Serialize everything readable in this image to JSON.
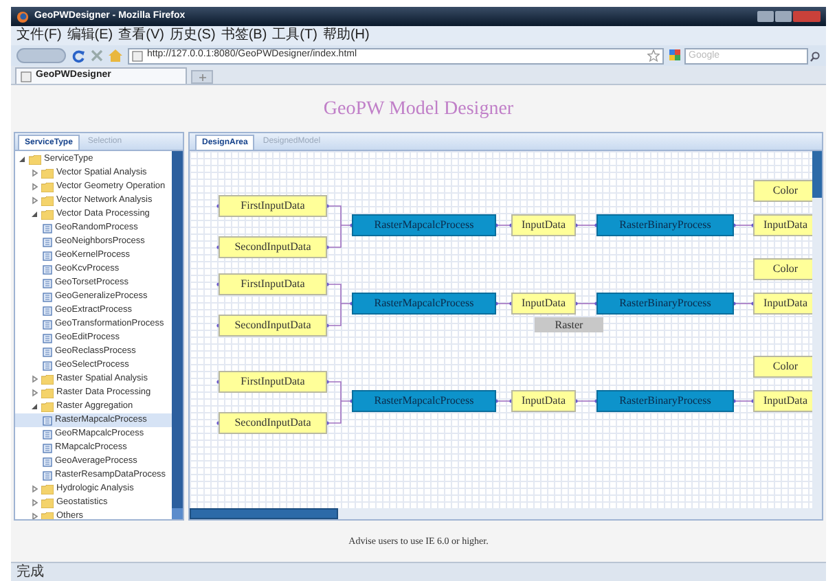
{
  "browser": {
    "title": "GeoPWDesigner - Mozilla Firefox",
    "menu": [
      "文件(F)",
      "编辑(E)",
      "查看(V)",
      "历史(S)",
      "书签(B)",
      "工具(T)",
      "帮助(H)"
    ],
    "url": "http://127.0.0.1:8080/GeoPWDesigner/index.html",
    "search": {
      "placeholder": "Google"
    },
    "tabs": [
      {
        "label": "GeoPWDesigner",
        "selected": true
      }
    ],
    "status": "完成"
  },
  "page": {
    "heading": "GeoPW Model Designer",
    "left_tabs": [
      {
        "label": "ServiceType",
        "selected": true
      },
      {
        "label": "Selection",
        "selected": false
      }
    ],
    "tree": [
      {
        "label": "ServiceType",
        "kind": "folder",
        "expanded": true,
        "selected": false,
        "children": [
          {
            "label": "Vector Spatial Analysis",
            "kind": "folder",
            "expanded": false,
            "selected": false
          },
          {
            "label": "Vector Geometry Operation",
            "kind": "folder",
            "expanded": false,
            "selected": false
          },
          {
            "label": "Vector Network Analysis",
            "kind": "folder",
            "expanded": false,
            "selected": false
          },
          {
            "label": "Vector Data Processing",
            "kind": "folder",
            "expanded": true,
            "selected": false,
            "children": [
              {
                "label": "GeoRandomProcess",
                "kind": "process",
                "selected": false
              },
              {
                "label": "GeoNeighborsProcess",
                "kind": "process",
                "selected": false
              },
              {
                "label": "GeoKernelProcess",
                "kind": "process",
                "selected": false
              },
              {
                "label": "GeoKcvProcess",
                "kind": "process",
                "selected": false
              },
              {
                "label": "GeoTorsetProcess",
                "kind": "process",
                "selected": false
              },
              {
                "label": "GeoGeneralizeProcess",
                "kind": "process",
                "selected": false
              },
              {
                "label": "GeoExtractProcess",
                "kind": "process",
                "selected": false
              },
              {
                "label": "GeoTransformationProcess",
                "kind": "process",
                "selected": false
              },
              {
                "label": "GeoEditProcess",
                "kind": "process",
                "selected": false
              },
              {
                "label": "GeoReclassProcess",
                "kind": "process",
                "selected": false
              },
              {
                "label": "GeoSelectProcess",
                "kind": "process",
                "selected": false
              }
            ]
          },
          {
            "label": "Raster Spatial Analysis",
            "kind": "folder",
            "expanded": false,
            "selected": false
          },
          {
            "label": "Raster Data Processing",
            "kind": "folder",
            "expanded": false,
            "selected": false
          },
          {
            "label": "Raster Aggregation",
            "kind": "folder",
            "expanded": true,
            "selected": false,
            "children": [
              {
                "label": "RasterMapcalcProcess",
                "kind": "process",
                "selected": true
              },
              {
                "label": "GeoRMapcalcProcess",
                "kind": "process",
                "selected": false
              },
              {
                "label": "RMapcalcProcess",
                "kind": "process",
                "selected": false
              },
              {
                "label": "GeoAverageProcess",
                "kind": "process",
                "selected": false
              },
              {
                "label": "RasterResampDataProcess",
                "kind": "process",
                "selected": false
              }
            ]
          },
          {
            "label": "Hydrologic Analysis",
            "kind": "folder",
            "expanded": false,
            "selected": false
          },
          {
            "label": "Geostatistics",
            "kind": "folder",
            "expanded": false,
            "selected": false
          },
          {
            "label": "Others",
            "kind": "folder",
            "expanded": false,
            "selected": false
          }
        ]
      }
    ],
    "design_tabs": [
      {
        "label": "DesignArea",
        "selected": true
      },
      {
        "label": "DesignedModel",
        "selected": false
      }
    ],
    "diagram": [
      {
        "inputs": [
          "FirstInputData",
          "SecondInputData"
        ],
        "process": "RasterMapcalcProcess",
        "intermediate": "InputData",
        "binary": "RasterBinaryProcess",
        "color_node": "Color",
        "output": "InputData"
      },
      {
        "inputs": [
          "FirstInputData",
          "SecondInputData"
        ],
        "process": "RasterMapcalcProcess",
        "intermediate": "InputData",
        "binary": "RasterBinaryProcess",
        "color_node": "Color",
        "output": "InputData",
        "tooltip": "Raster"
      },
      {
        "inputs": [
          "FirstInputData",
          "SecondInputData"
        ],
        "process": "RasterMapcalcProcess",
        "intermediate": "InputData",
        "binary": "RasterBinaryProcess",
        "color_node": "Color",
        "output": "InputData"
      }
    ],
    "footer": "Advise users to use IE 6.0 or higher."
  }
}
